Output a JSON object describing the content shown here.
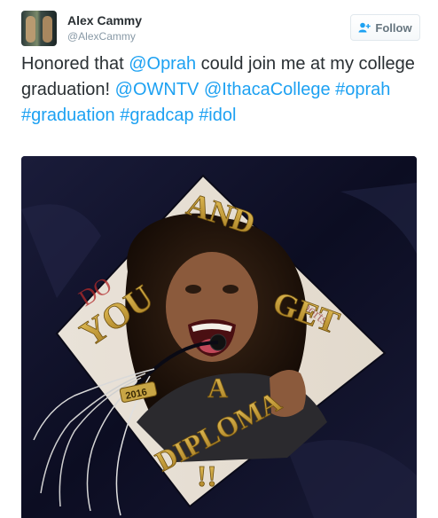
{
  "user": {
    "name": "Alex Cammy",
    "handle": "@AlexCammy"
  },
  "follow_button": {
    "label": "Follow"
  },
  "tweet": {
    "prefix": "Honored that ",
    "mention_oprah": "@Oprah",
    "middle": " could join me at my college graduation! ",
    "mention_ownt": "@OWNTV",
    "mention_ithaca": "@IthacaCollege",
    "tag_oprah": "#oprah",
    "tag_graduation": "#graduation",
    "tag_gradcap": "#gradcap",
    "tag_idol": "#idol"
  },
  "photo": {
    "cap_words": [
      "AND",
      "YOU",
      "GET",
      "A",
      "DIPLOMA",
      "!!"
    ],
    "tassel_charm": "2016"
  },
  "colors": {
    "link": "#1da1f2",
    "gold_glitter": "#c9a13a",
    "gown_navy": "#0f1024"
  },
  "icons": {
    "follow": "person-plus-icon"
  }
}
